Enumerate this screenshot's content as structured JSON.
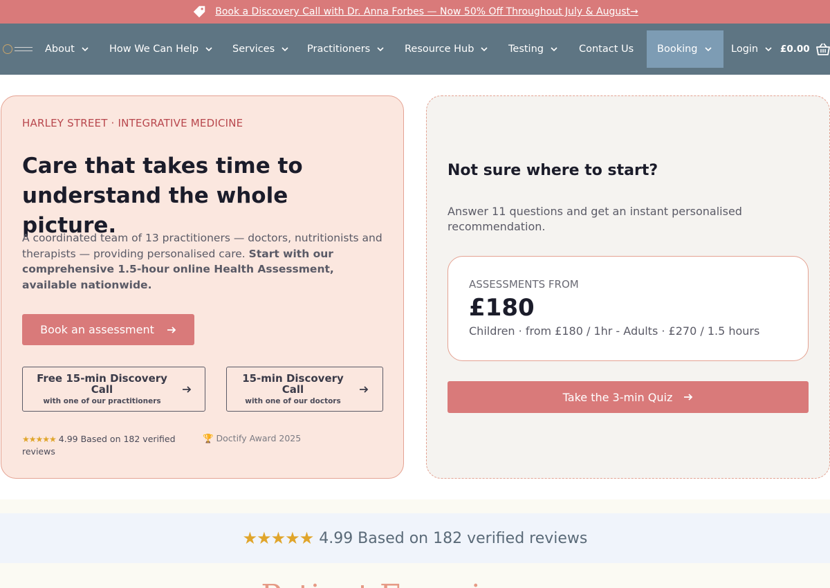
{
  "promo": {
    "text": "Book a Discovery Call with Dr. Anna Forbes — Now 50% Off Throughout July & August→",
    "icon": "tag-icon"
  },
  "nav": {
    "items": [
      {
        "label": "About",
        "has_dropdown": true
      },
      {
        "label": "How We Can Help",
        "has_dropdown": true
      },
      {
        "label": "Services",
        "has_dropdown": true
      },
      {
        "label": "Practitioners",
        "has_dropdown": true
      },
      {
        "label": "Resource Hub",
        "has_dropdown": true
      },
      {
        "label": "Testing",
        "has_dropdown": true
      },
      {
        "label": "Contact Us",
        "has_dropdown": false
      },
      {
        "label": "Booking",
        "has_dropdown": true,
        "active": true
      },
      {
        "label": "Login",
        "has_dropdown": true
      }
    ],
    "cart_total": "£0.00",
    "cart_icon": "basket-icon"
  },
  "hero": {
    "eyebrow": "HARLEY STREET · INTEGRATIVE MEDICINE",
    "title": "Care that takes time to understand the whole picture.",
    "description_plain": "A coordinated team of 13 practitioners — doctors, nutritionists and therapists — providing personalised care. ",
    "description_bold": "Start with our comprehensive 1.5-hour online Health Assessment, available nationwide.",
    "primary_button": "Book an assessment",
    "secondary_buttons": [
      {
        "title": "Free 15-min Discovery Call",
        "subtitle": "with one of our practitioners"
      },
      {
        "title": "15-min Discovery Call",
        "subtitle": "with one of our doctors"
      }
    ],
    "rating_stars": "★★★★★",
    "rating_text": "4.99 Based on 182 verified reviews",
    "award": "🏆 Doctify Award 2025"
  },
  "quiz": {
    "title": "Not sure where to start?",
    "description": "Answer 11 questions and get an instant personalised recommendation.",
    "price_label": "ASSESSMENTS FROM",
    "price_value": "£180",
    "price_note": "Children · from £180 / 1hr - Adults · £270 / 1.5 hours",
    "button": "Take the 3-min Quiz"
  },
  "reviews_band": {
    "stars": "★★★★★",
    "text": "4.99 Based on 182 verified reviews"
  },
  "next_section": {
    "heading": "Patient Experiences"
  },
  "colors": {
    "accent": "#d97a7a",
    "nav_bg": "#5e7583",
    "nav_active": "#7d9cb4",
    "hero_bg": "#fbe7df",
    "eyebrow": "#b8474d",
    "star": "#e0a52b"
  }
}
